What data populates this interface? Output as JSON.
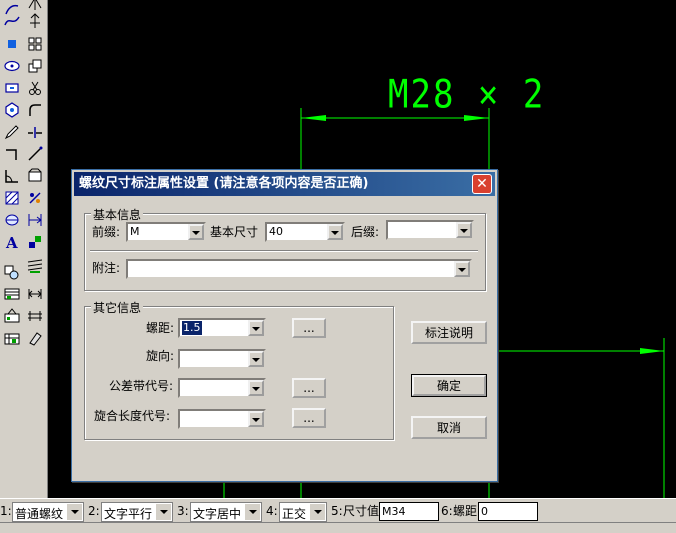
{
  "dimension_text": "M28 × 2",
  "colors": {
    "cad_green": "#00ff00",
    "title_start": "#0a246a",
    "title_end": "#3a6ea5",
    "close_red": "#d9402f"
  },
  "dialog": {
    "title": "螺纹尺寸标注属性设置 (请注意各项内容是否正确)",
    "basic_group": {
      "title": "基本信息",
      "prefix_label": "前缀:",
      "prefix_value": "M",
      "basic_size_label": "基本尺寸",
      "basic_size_value": "40",
      "suffix_label": "后缀:",
      "suffix_value": "",
      "note_label": "附注:",
      "note_value": ""
    },
    "other_group": {
      "title": "其它信息",
      "pitch_label": "螺距:",
      "pitch_value": "1.5",
      "direction_label": "旋向:",
      "direction_value": "",
      "tolerance_label": "公差带代号:",
      "tolerance_value": "",
      "length_label": "旋合长度代号:",
      "length_value": "",
      "ellipsis_label": "..."
    },
    "buttons": {
      "help": "标注说明",
      "ok": "确定",
      "cancel": "取消"
    }
  },
  "bottom_bar": [
    {
      "num": "1:",
      "value": "普通螺纹",
      "type": "combo"
    },
    {
      "num": "2:",
      "value": "文字平行",
      "type": "combo"
    },
    {
      "num": "3:",
      "value": "文字居中",
      "type": "combo"
    },
    {
      "num": "4:",
      "value": "正交",
      "type": "combo"
    },
    {
      "num": "5:",
      "label": "尺寸值",
      "value": "M34",
      "type": "input"
    },
    {
      "num": "6:",
      "label": "螺距",
      "value": "0",
      "type": "input"
    }
  ],
  "toolbar_icons": [
    "arc-icon",
    "spline-icon",
    "point-icon",
    "ellipse-icon",
    "rectangle-icon",
    "polygon-icon",
    "pencil-icon",
    "polyline-icon",
    "angle-icon",
    "hatch-icon",
    "table-icon",
    "text-icon",
    "zoom-icon",
    "layer-icon",
    "block-icon",
    "insert-icon",
    "mirror-icon",
    "move-icon",
    "array-icon",
    "copy-icon",
    "trim-icon",
    "fillet-icon",
    "break-icon",
    "extend-icon",
    "chamfer-icon",
    "explode-icon",
    "align-icon",
    "offset-icon",
    "stretch-icon",
    "scale-icon",
    "lengthen-icon",
    "erase-icon"
  ]
}
